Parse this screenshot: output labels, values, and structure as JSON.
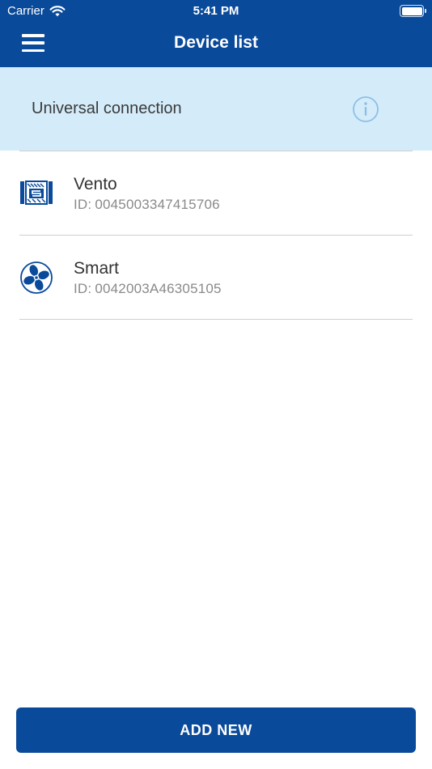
{
  "status_bar": {
    "carrier": "Carrier",
    "time": "5:41 PM"
  },
  "nav": {
    "title": "Device list",
    "menu_icon": "hamburger-menu-icon"
  },
  "banner": {
    "label": "Universal connection",
    "icon": "info-icon"
  },
  "devices": [
    {
      "name": "Vento",
      "id_prefix": "ID:",
      "id": "0045003347415706",
      "icon": "vento-unit-icon"
    },
    {
      "name": "Smart",
      "id_prefix": "ID:",
      "id": "0042003A46305105",
      "icon": "fan-icon"
    }
  ],
  "add_button": {
    "label": "ADD NEW"
  },
  "colors": {
    "primary": "#0a4a9a",
    "banner_bg": "#d4ecf9",
    "info_icon": "#8fbfe6",
    "divider": "#cfcfcf"
  }
}
